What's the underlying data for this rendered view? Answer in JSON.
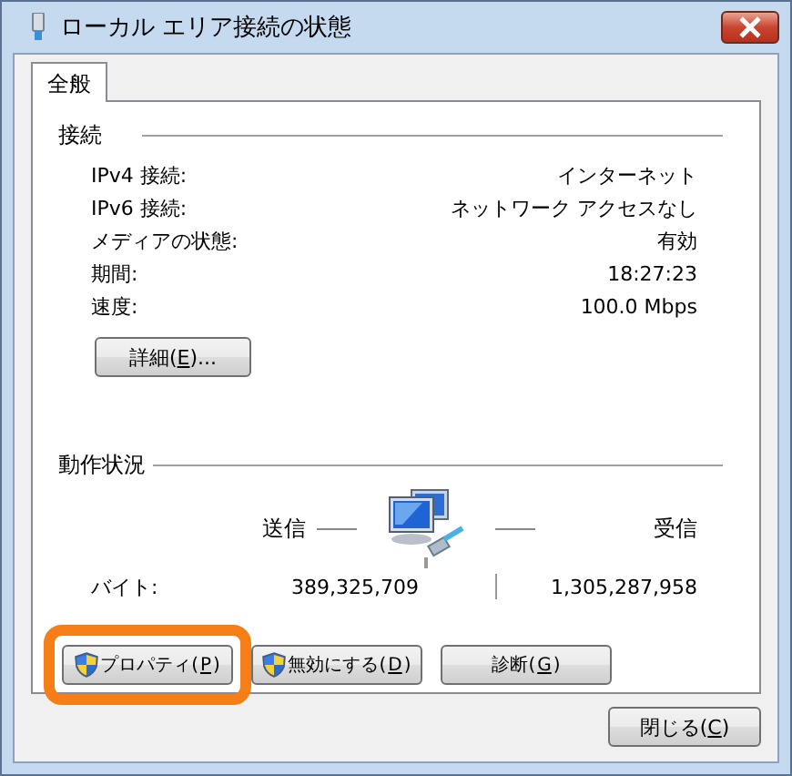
{
  "window": {
    "title": "ローカル エリア接続の状態"
  },
  "tabs": [
    {
      "label": "全般",
      "selected": true
    }
  ],
  "connection": {
    "heading": "接続",
    "rows": [
      {
        "label": "IPv4 接続:",
        "value": "インターネット"
      },
      {
        "label": "IPv6 接続:",
        "value": "ネットワーク アクセスなし"
      },
      {
        "label": "メディアの状態:",
        "value": "有効"
      },
      {
        "label": "期間:",
        "value": "18:27:23"
      },
      {
        "label": "速度:",
        "value": "100.0 Mbps"
      }
    ],
    "details_button": {
      "before": "詳細(",
      "key": "E",
      "after": ")..."
    }
  },
  "activity": {
    "heading": "動作状況",
    "sent_label": "送信",
    "received_label": "受信",
    "bytes_label": "バイト:",
    "bytes_sent": "389,325,709",
    "bytes_received": "1,305,287,958"
  },
  "buttons": [
    {
      "before": "プロパティ(",
      "key": "P",
      "after": ")",
      "shield": true,
      "highlighted": true
    },
    {
      "before": "無効にする(",
      "key": "D",
      "after": ")",
      "shield": true,
      "highlighted": false
    },
    {
      "before": "診断(",
      "key": "G",
      "after": ")",
      "shield": false,
      "highlighted": false
    }
  ],
  "close_button": {
    "before": "閉じる(",
    "key": "C",
    "after": ")"
  }
}
